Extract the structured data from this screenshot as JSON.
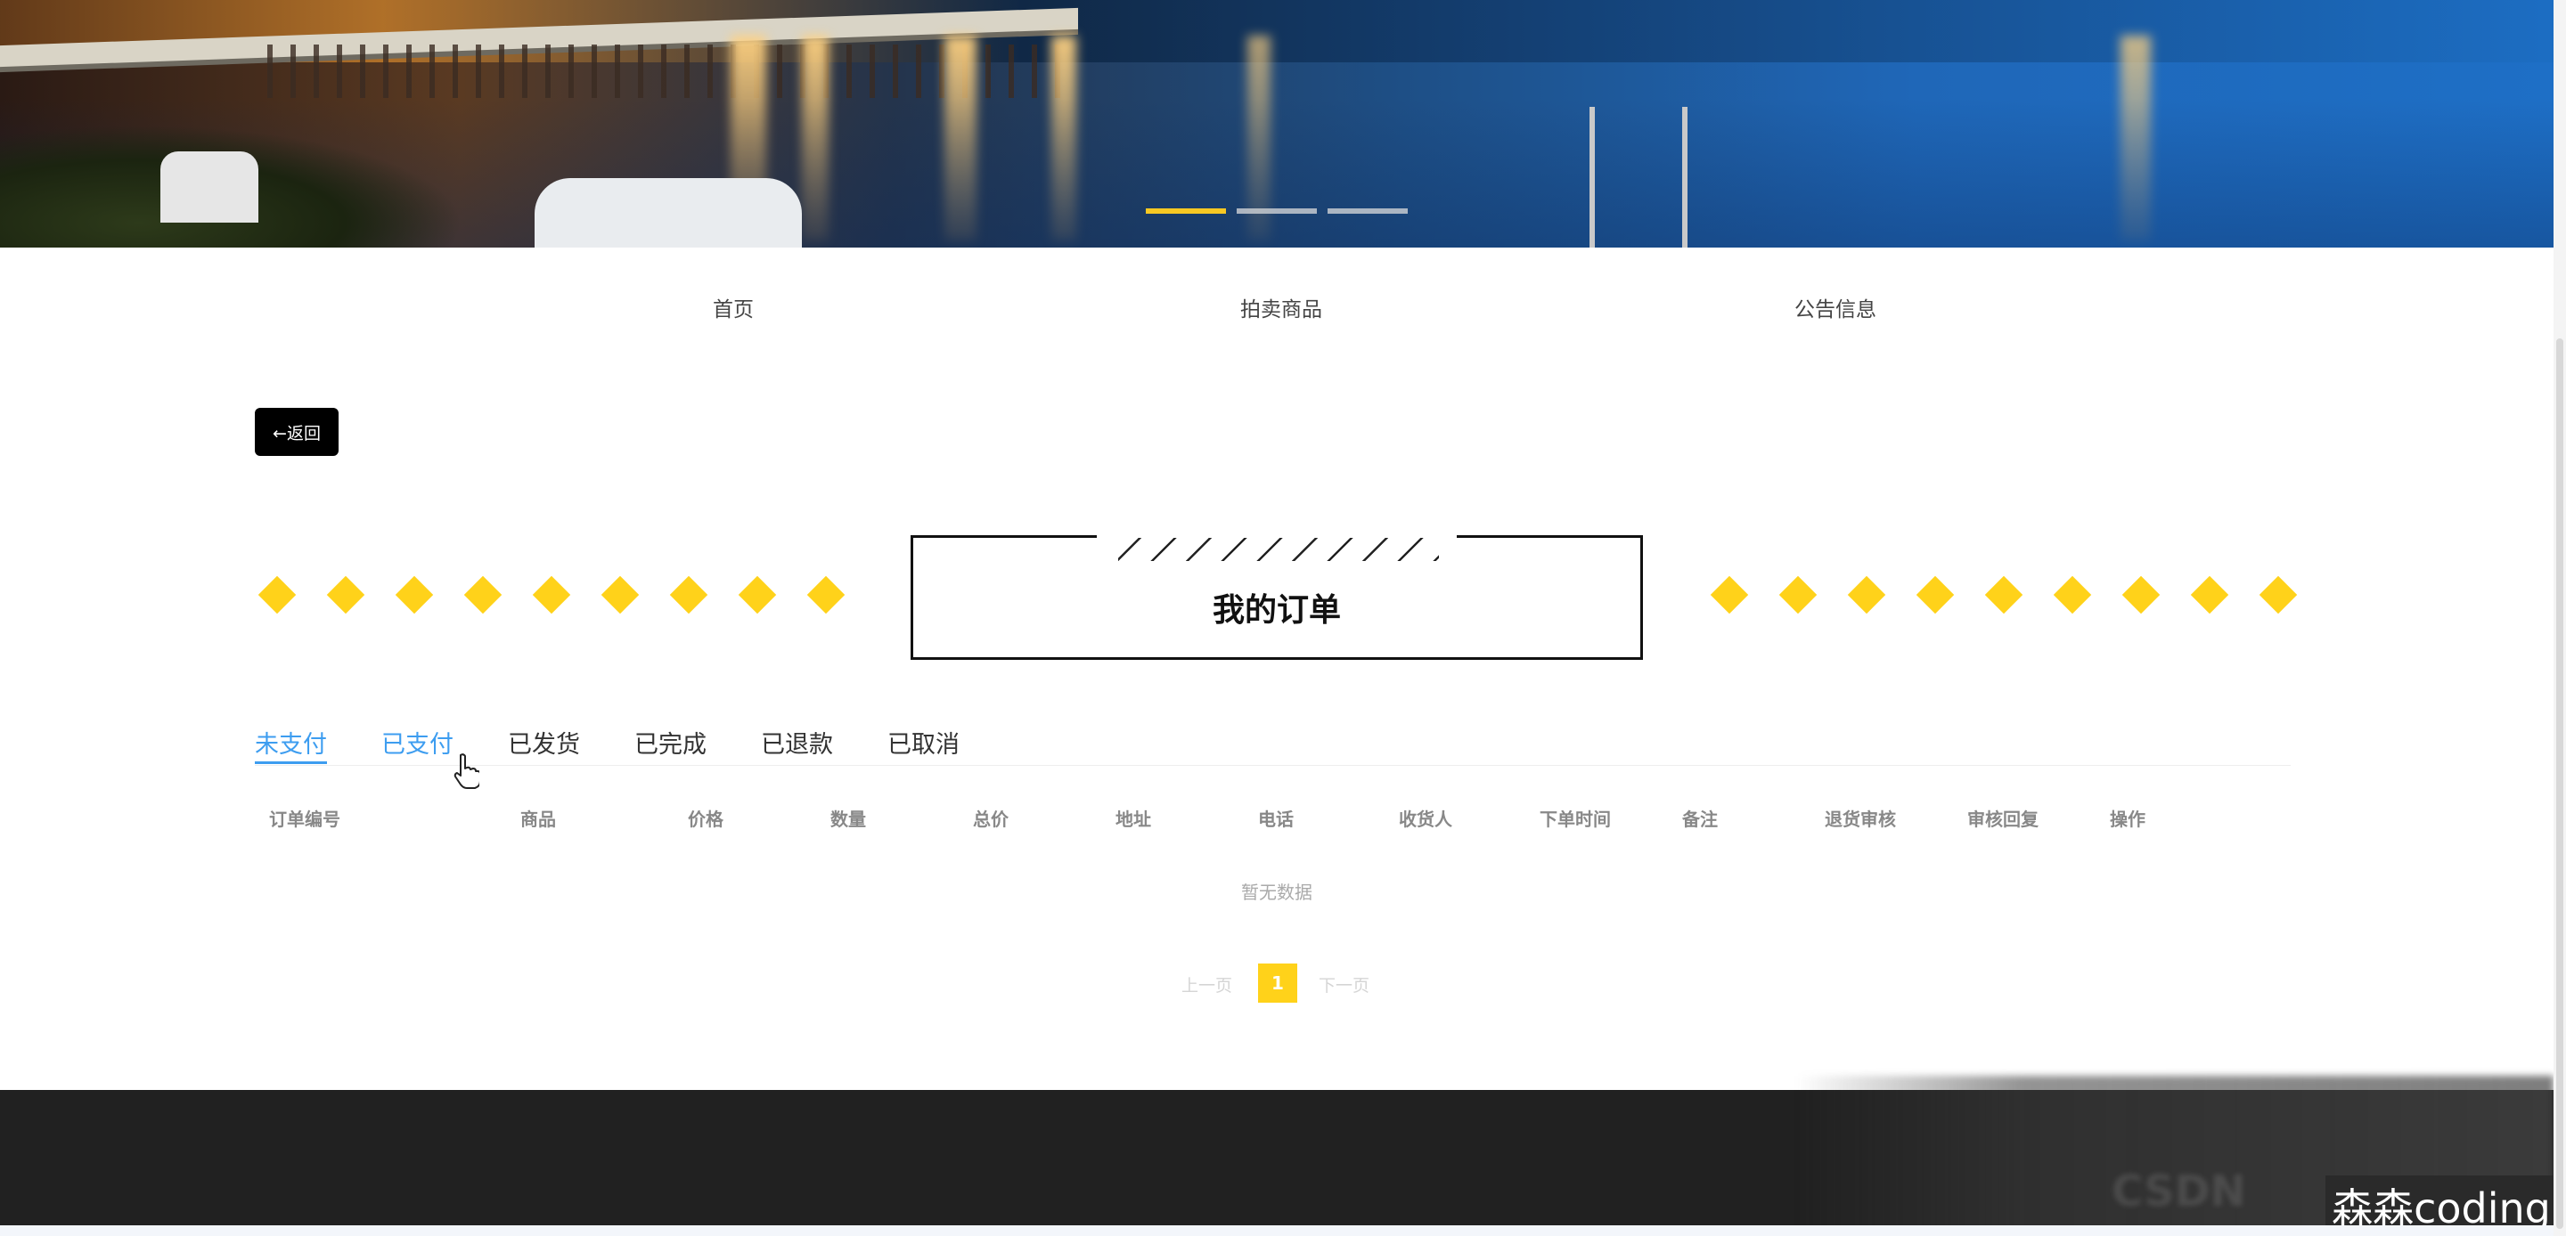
{
  "nav": {
    "items": [
      "首页",
      "拍卖商品",
      "公告信息"
    ]
  },
  "back_button": {
    "label": "←返回"
  },
  "page_title": "我的订单",
  "carousel": {
    "active_index": 0,
    "count": 3
  },
  "tabs": [
    "未支付",
    "已支付",
    "已发货",
    "已完成",
    "已退款",
    "已取消"
  ],
  "active_tab": "未支付",
  "table": {
    "columns": [
      "订单编号",
      "商品",
      "价格",
      "数量",
      "总价",
      "地址",
      "电话",
      "收货人",
      "下单时间",
      "备注",
      "退货审核",
      "审核回复",
      "操作"
    ],
    "rows": [],
    "empty_text": "暂无数据"
  },
  "pagination": {
    "prev_label": "上一页",
    "next_label": "下一页",
    "current_page": "1"
  },
  "watermark": "森森coding",
  "colors": {
    "accent_yellow": "#ffd21a",
    "tab_active_blue": "#3d9df0",
    "footer_bg": "#212121",
    "back_button_bg": "#000000"
  }
}
